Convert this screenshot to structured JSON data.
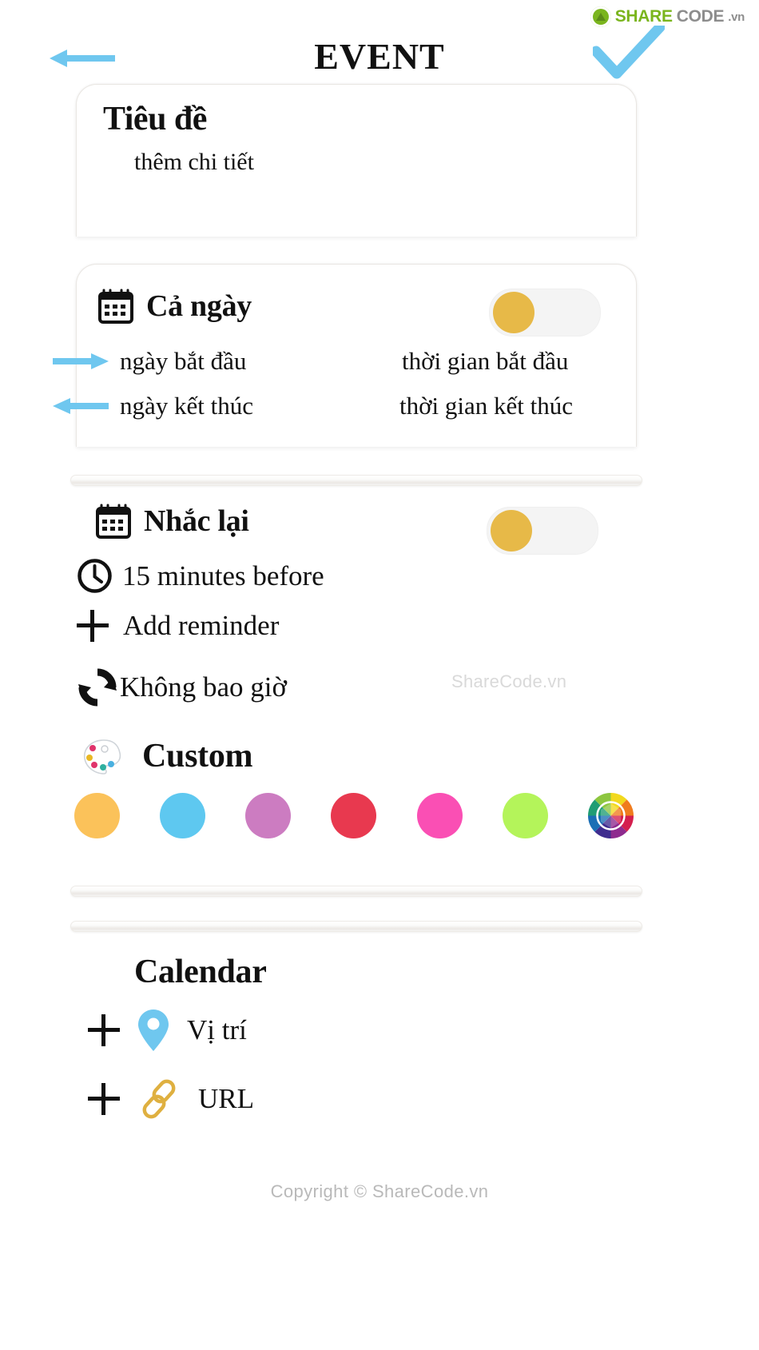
{
  "brand": {
    "logo_share": "SHARE",
    "logo_code": "CODE",
    "logo_tld": ".vn",
    "mid_watermark": "ShareCode.vn",
    "copyright": "Copyright © ShareCode.vn"
  },
  "header": {
    "title": "EVENT",
    "back_icon": "back-arrow-icon",
    "confirm_icon": "checkmark-icon",
    "accent_color": "#6fc7ef"
  },
  "title_card": {
    "title": "Tiêu đề",
    "subtitle": "thêm chi tiết"
  },
  "date_card": {
    "heading": "Cả ngày",
    "heading_icon": "calendar-icon",
    "toggle_on": false,
    "toggle_knob_color": "#e7b948",
    "start_date": "ngày bắt đầu",
    "start_time": "thời gian bắt đầu",
    "end_date": "ngày kết thúc",
    "end_time": "thời gian kết thúc"
  },
  "reminder": {
    "heading": "Nhắc lại",
    "heading_icon": "calendar-icon",
    "toggle_on": false,
    "toggle_knob_color": "#e7b948",
    "reminder_value": "15 minutes before",
    "reminder_icon": "clock-icon",
    "add_reminder": "Add reminder",
    "add_icon": "plus-icon",
    "repeat_value": "Không bao giờ",
    "repeat_icon": "repeat-icon"
  },
  "custom": {
    "heading": "Custom",
    "heading_icon": "palette-icon",
    "swatches": [
      {
        "name": "swatch-amber",
        "color": "#fbc25a"
      },
      {
        "name": "swatch-skyblue",
        "color": "#5ec8f0"
      },
      {
        "name": "swatch-orchid",
        "color": "#cc7cc1"
      },
      {
        "name": "swatch-crimson",
        "color": "#e8394f"
      },
      {
        "name": "swatch-pink",
        "color": "#fa4fb4"
      },
      {
        "name": "swatch-lime",
        "color": "#b4f45a"
      },
      {
        "name": "swatch-rainbow",
        "color": "rainbow"
      }
    ]
  },
  "calendar": {
    "heading": "Calendar",
    "location_label": "Vị trí",
    "location_icon": "map-pin-icon",
    "location_icon_color": "#6fc7ef",
    "url_label": "URL",
    "url_icon": "link-icon",
    "url_icon_color": "#dfb040",
    "add_icon": "plus-icon"
  }
}
